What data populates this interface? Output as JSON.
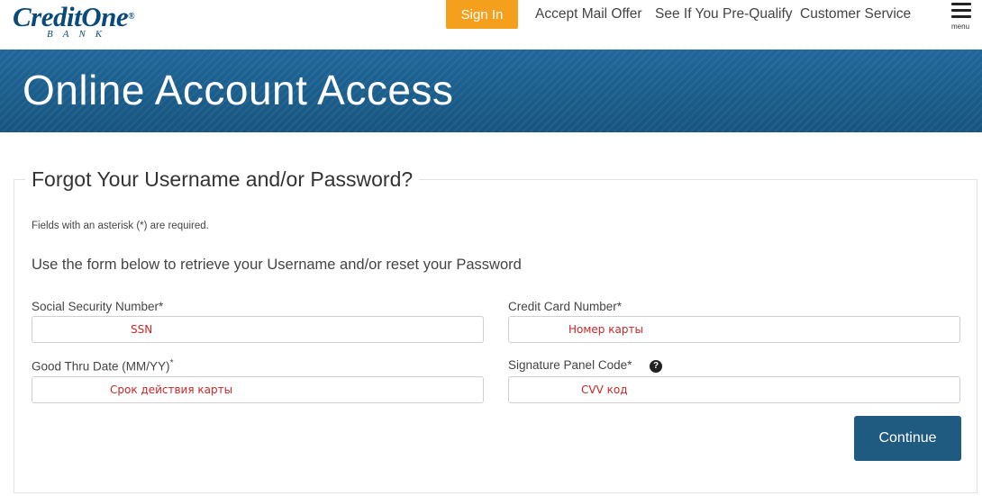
{
  "header": {
    "logo_text": "CreditOne",
    "logo_reg": "®",
    "logo_sub": "BANK",
    "signin_label": "Sign In",
    "nav": [
      "Accept Mail Offer",
      "See If You Pre-Qualify",
      "Customer Service"
    ],
    "menu_label": "menu"
  },
  "banner": {
    "title": "Online Account Access"
  },
  "form": {
    "legend": "Forgot Your Username and/or Password?",
    "required_note": "Fields with an asterisk (*) are required.",
    "intro": "Use the form below to retrieve your Username and/or reset your Password",
    "fields": {
      "ssn": {
        "label": "Social Security Number*",
        "placeholder": "SSN"
      },
      "card": {
        "label": "Credit Card Number*",
        "placeholder": "Номер карты"
      },
      "good_thru": {
        "label": "Good Thru Date (MM/YY)",
        "label_suffix": "*",
        "placeholder": "Срок действия карты"
      },
      "sig_code": {
        "label": "Signature Panel Code*",
        "placeholder": "CVV код"
      }
    },
    "continue_label": "Continue"
  },
  "colors": {
    "brand_blue": "#0a4a7a",
    "signin_orange": "#f5a01c",
    "banner_blue": "#1b5f8e",
    "button_blue": "#1f5a80",
    "placeholder_red": "#c62828"
  },
  "icons": {
    "menu": "hamburger-icon",
    "help": "question-circle-icon"
  }
}
